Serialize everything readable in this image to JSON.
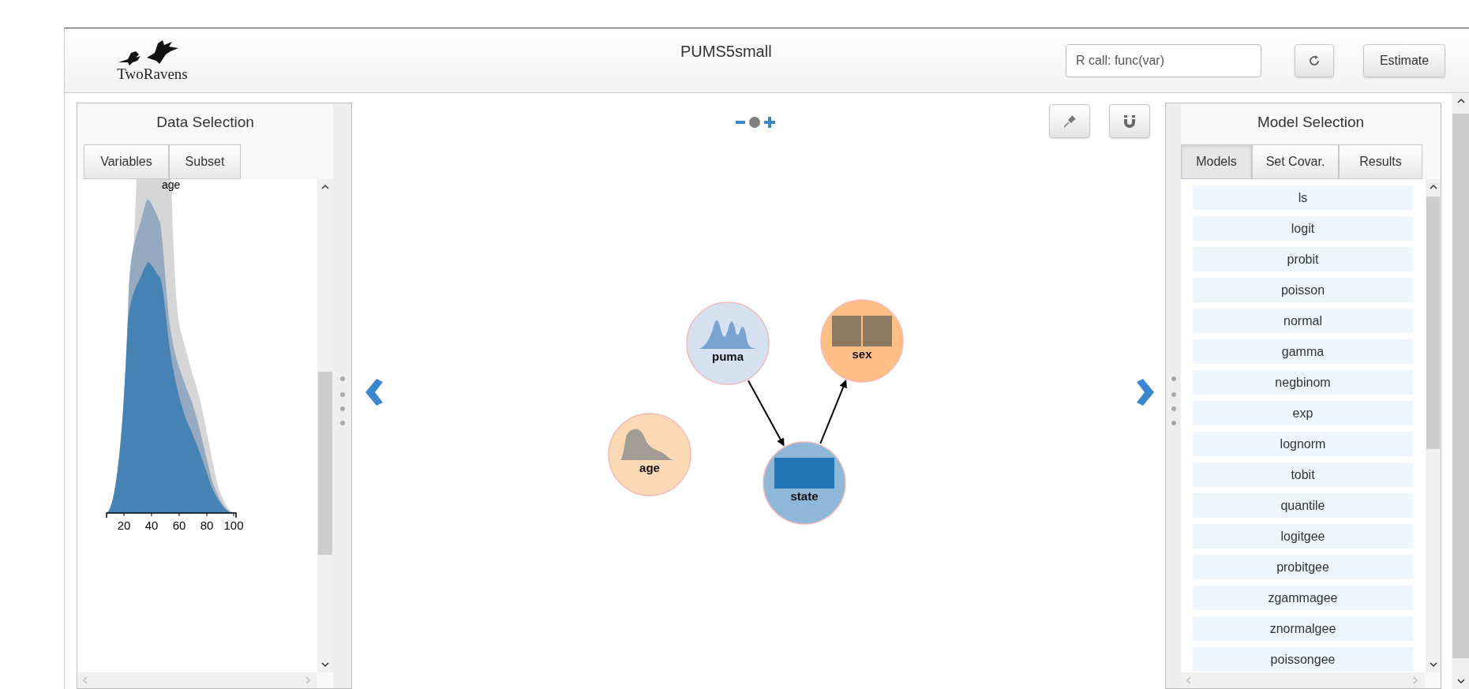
{
  "header": {
    "logo_text": "TwoRavens",
    "dataset_title": "PUMS5small",
    "r_call": {
      "placeholder": "R call: func(var)"
    },
    "estimate_button": "Estimate"
  },
  "left_panel": {
    "title": "Data Selection",
    "tabs": [
      {
        "label": "Variables",
        "selected": false
      },
      {
        "label": "Subset",
        "selected": false
      }
    ],
    "plot": {
      "variable": "age",
      "axis_ticks": [
        "20",
        "40",
        "60",
        "80",
        "100"
      ]
    }
  },
  "graph": {
    "nodes": [
      {
        "label": "puma",
        "color": "#d5e1f0",
        "kind": "peaks"
      },
      {
        "label": "sex",
        "color": "#ffbf87",
        "kind": "bars"
      },
      {
        "label": "age",
        "color": "#fcd9b5",
        "kind": "density"
      },
      {
        "label": "state",
        "color": "#8fb8d8",
        "kind": "bar"
      }
    ]
  },
  "right_panel": {
    "title": "Model Selection",
    "tabs": [
      {
        "label": "Models",
        "selected": true
      },
      {
        "label": "Set Covar.",
        "selected": false
      },
      {
        "label": "Results",
        "selected": false
      }
    ],
    "models": [
      "ls",
      "logit",
      "probit",
      "poisson",
      "normal",
      "gamma",
      "negbinom",
      "exp",
      "lognorm",
      "tobit",
      "quantile",
      "logitgee",
      "probitgee",
      "zgammagee",
      "znormalgee",
      "poissongee"
    ]
  }
}
